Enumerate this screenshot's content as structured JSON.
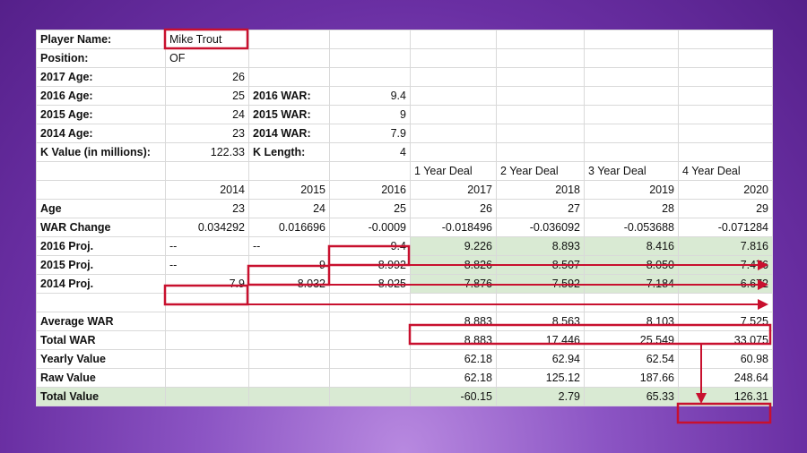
{
  "sheet": {
    "rows": [
      [
        {
          "t": "Player Name:",
          "b": 1
        },
        {
          "t": "Mike Trout"
        },
        {
          "t": ""
        },
        {
          "t": ""
        },
        {
          "t": ""
        },
        {
          "t": ""
        },
        {
          "t": ""
        },
        {
          "t": ""
        }
      ],
      [
        {
          "t": "Position:",
          "b": 1
        },
        {
          "t": "OF"
        },
        {
          "t": ""
        },
        {
          "t": ""
        },
        {
          "t": ""
        },
        {
          "t": ""
        },
        {
          "t": ""
        },
        {
          "t": ""
        }
      ],
      [
        {
          "t": "2017 Age:",
          "b": 1
        },
        {
          "t": "26",
          "r": 1
        },
        {
          "t": ""
        },
        {
          "t": ""
        },
        {
          "t": ""
        },
        {
          "t": ""
        },
        {
          "t": ""
        },
        {
          "t": ""
        }
      ],
      [
        {
          "t": "2016 Age:",
          "b": 1
        },
        {
          "t": "25",
          "r": 1
        },
        {
          "t": "2016 WAR:",
          "b": 1
        },
        {
          "t": "9.4",
          "r": 1
        },
        {
          "t": ""
        },
        {
          "t": ""
        },
        {
          "t": ""
        },
        {
          "t": ""
        }
      ],
      [
        {
          "t": "2015 Age:",
          "b": 1
        },
        {
          "t": "24",
          "r": 1
        },
        {
          "t": "2015 WAR:",
          "b": 1
        },
        {
          "t": "9",
          "r": 1
        },
        {
          "t": ""
        },
        {
          "t": ""
        },
        {
          "t": ""
        },
        {
          "t": ""
        }
      ],
      [
        {
          "t": "2014 Age:",
          "b": 1
        },
        {
          "t": "23",
          "r": 1
        },
        {
          "t": "2014 WAR:",
          "b": 1
        },
        {
          "t": "7.9",
          "r": 1
        },
        {
          "t": ""
        },
        {
          "t": ""
        },
        {
          "t": ""
        },
        {
          "t": ""
        }
      ],
      [
        {
          "t": "K Value (in millions):",
          "b": 1
        },
        {
          "t": "122.33",
          "r": 1
        },
        {
          "t": "K Length:",
          "b": 1
        },
        {
          "t": "4",
          "r": 1
        },
        {
          "t": ""
        },
        {
          "t": ""
        },
        {
          "t": ""
        },
        {
          "t": ""
        }
      ],
      [
        {
          "t": ""
        },
        {
          "t": ""
        },
        {
          "t": ""
        },
        {
          "t": ""
        },
        {
          "t": "1 Year Deal"
        },
        {
          "t": "2 Year Deal"
        },
        {
          "t": "3 Year Deal"
        },
        {
          "t": "4 Year Deal"
        }
      ],
      [
        {
          "t": ""
        },
        {
          "t": "2014",
          "r": 1
        },
        {
          "t": "2015",
          "r": 1
        },
        {
          "t": "2016",
          "r": 1
        },
        {
          "t": "2017",
          "r": 1
        },
        {
          "t": "2018",
          "r": 1
        },
        {
          "t": "2019",
          "r": 1
        },
        {
          "t": "2020",
          "r": 1
        }
      ],
      [
        {
          "t": "Age",
          "b": 1
        },
        {
          "t": "23",
          "r": 1
        },
        {
          "t": "24",
          "r": 1
        },
        {
          "t": "25",
          "r": 1
        },
        {
          "t": "26",
          "r": 1
        },
        {
          "t": "27",
          "r": 1
        },
        {
          "t": "28",
          "r": 1
        },
        {
          "t": "29",
          "r": 1
        }
      ],
      [
        {
          "t": "WAR Change",
          "b": 1
        },
        {
          "t": "0.034292",
          "r": 1
        },
        {
          "t": "0.016696",
          "r": 1
        },
        {
          "t": "-0.0009",
          "r": 1
        },
        {
          "t": "-0.018496",
          "r": 1
        },
        {
          "t": "-0.036092",
          "r": 1
        },
        {
          "t": "-0.053688",
          "r": 1
        },
        {
          "t": "-0.071284",
          "r": 1
        }
      ],
      [
        {
          "t": "2016 Proj.",
          "b": 1
        },
        {
          "t": "--"
        },
        {
          "t": "--"
        },
        {
          "t": "9.4",
          "r": 1
        },
        {
          "t": "9.226",
          "r": 1,
          "g": 1
        },
        {
          "t": "8.893",
          "r": 1,
          "g": 1
        },
        {
          "t": "8.416",
          "r": 1,
          "g": 1
        },
        {
          "t": "7.816",
          "r": 1,
          "g": 1
        }
      ],
      [
        {
          "t": "2015 Proj.",
          "b": 1
        },
        {
          "t": "--"
        },
        {
          "t": "9",
          "r": 1
        },
        {
          "t": "8.992",
          "r": 1
        },
        {
          "t": "8.826",
          "r": 1,
          "g": 1
        },
        {
          "t": "8.507",
          "r": 1,
          "g": 1
        },
        {
          "t": "8.050",
          "r": 1,
          "g": 1
        },
        {
          "t": "7.476",
          "r": 1,
          "g": 1
        }
      ],
      [
        {
          "t": "2014 Proj.",
          "b": 1
        },
        {
          "t": "7.9",
          "r": 1
        },
        {
          "t": "8.032",
          "r": 1
        },
        {
          "t": "8.025",
          "r": 1
        },
        {
          "t": "7.876",
          "r": 1,
          "g": 1
        },
        {
          "t": "7.592",
          "r": 1,
          "g": 1
        },
        {
          "t": "7.184",
          "r": 1,
          "g": 1
        },
        {
          "t": "6.672",
          "r": 1,
          "g": 1
        }
      ],
      [
        {
          "t": ""
        },
        {
          "t": ""
        },
        {
          "t": ""
        },
        {
          "t": ""
        },
        {
          "t": ""
        },
        {
          "t": ""
        },
        {
          "t": ""
        },
        {
          "t": ""
        }
      ],
      [
        {
          "t": "Average WAR",
          "b": 1
        },
        {
          "t": ""
        },
        {
          "t": ""
        },
        {
          "t": ""
        },
        {
          "t": "8.883",
          "r": 1
        },
        {
          "t": "8.563",
          "r": 1
        },
        {
          "t": "8.103",
          "r": 1
        },
        {
          "t": "7.525",
          "r": 1
        }
      ],
      [
        {
          "t": "Total WAR",
          "b": 1
        },
        {
          "t": ""
        },
        {
          "t": ""
        },
        {
          "t": ""
        },
        {
          "t": "8.883",
          "r": 1
        },
        {
          "t": "17.446",
          "r": 1
        },
        {
          "t": "25.549",
          "r": 1
        },
        {
          "t": "33.075",
          "r": 1
        }
      ],
      [
        {
          "t": "Yearly Value",
          "b": 1
        },
        {
          "t": ""
        },
        {
          "t": ""
        },
        {
          "t": ""
        },
        {
          "t": "62.18",
          "r": 1
        },
        {
          "t": "62.94",
          "r": 1
        },
        {
          "t": "62.54",
          "r": 1
        },
        {
          "t": "60.98",
          "r": 1
        }
      ],
      [
        {
          "t": "Raw Value",
          "b": 1
        },
        {
          "t": ""
        },
        {
          "t": ""
        },
        {
          "t": ""
        },
        {
          "t": "62.18",
          "r": 1
        },
        {
          "t": "125.12",
          "r": 1
        },
        {
          "t": "187.66",
          "r": 1
        },
        {
          "t": "248.64",
          "r": 1
        }
      ],
      [
        {
          "t": "Total Value",
          "b": 1,
          "g": 1
        },
        {
          "t": "",
          "g": 1
        },
        {
          "t": "",
          "g": 1
        },
        {
          "t": "",
          "g": 1
        },
        {
          "t": "-60.15",
          "r": 1,
          "g": 1
        },
        {
          "t": "2.79",
          "r": 1,
          "g": 1
        },
        {
          "t": "65.33",
          "r": 1,
          "g": 1
        },
        {
          "t": "126.31",
          "r": 1,
          "g": 1
        }
      ]
    ]
  },
  "colors": {
    "highlight_green": "#d9ead3",
    "annotation_red": "#c8102e"
  }
}
